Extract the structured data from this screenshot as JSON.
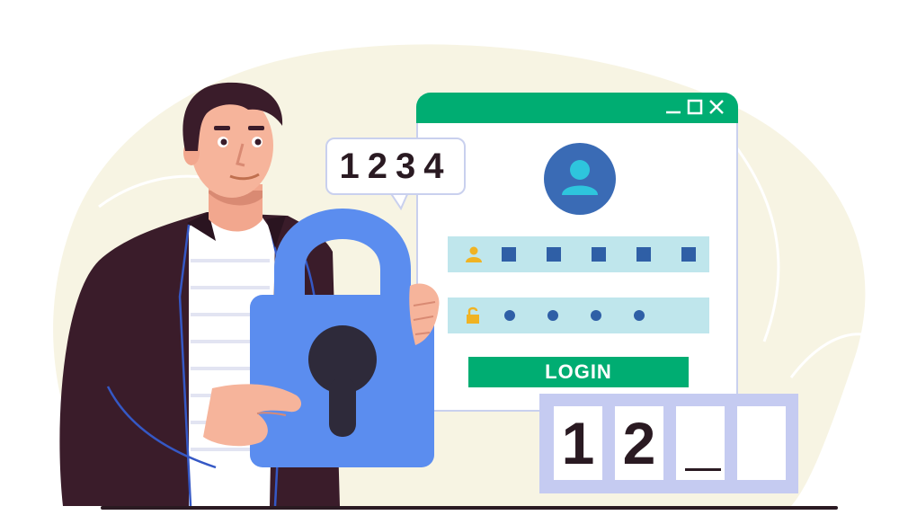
{
  "speech_bubble": {
    "text": "1234"
  },
  "login_window": {
    "login_button_label": "LOGIN",
    "username_mask_count": 5,
    "password_mask_count": 4
  },
  "pin_entry": {
    "digits": [
      "1",
      "2",
      "",
      ""
    ]
  },
  "colors": {
    "accent_green": "#00ad72",
    "field_fill": "#bfe6ec",
    "mask_blue": "#2f5fa6",
    "padlock_blue": "#5b8def",
    "dark": "#2a1a22",
    "background_blob": "#f7f4e3"
  },
  "icons": [
    "minimize-icon",
    "maximize-icon",
    "close-icon",
    "user-avatar-icon",
    "user-icon",
    "unlocked-padlock-icon",
    "padlock-icon"
  ]
}
